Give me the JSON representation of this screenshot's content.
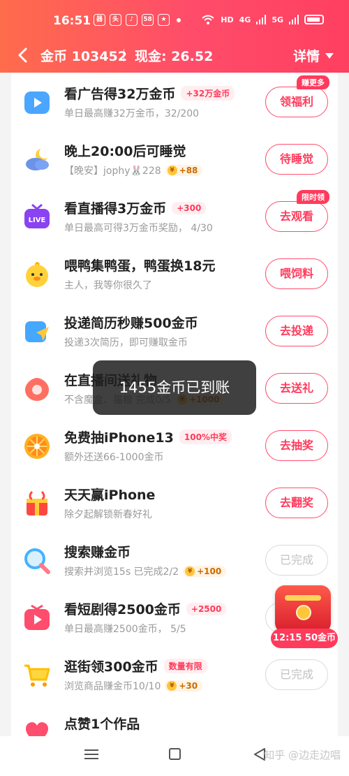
{
  "status_bar": {
    "time": "16:51",
    "app_icons": [
      "wechat-alt-icon",
      "video-app-icon",
      "tiktok-icon",
      "shopping-app-icon",
      "game-app-icon"
    ],
    "right_labels": [
      "HD",
      "4G",
      "5G"
    ]
  },
  "nav": {
    "coins_label": "金币 103452",
    "cash_label": "现金: 26.52",
    "detail_label": "详情"
  },
  "tasks": [
    {
      "icon": "video-play-icon",
      "title": "看广告得32万金币",
      "badge": "+32万金币",
      "subtitle": "单日最高赚32万金币，32/200",
      "coin_badge": "",
      "button": "领福利",
      "tag": "赚更多",
      "done": false
    },
    {
      "icon": "moon-cloud-icon",
      "title": "晚上20:00后可睡觉",
      "badge": "",
      "subtitle": "【晚安】jophy🐰228",
      "coin_badge": "+88",
      "button": "待睡觉",
      "tag": "",
      "done": false
    },
    {
      "icon": "live-tv-icon",
      "title": "看直播得3万金币",
      "badge": "+300",
      "subtitle": "单日最高可得3万金币奖励， 4/30",
      "coin_badge": "",
      "button": "去观看",
      "tag": "限时领",
      "done": false
    },
    {
      "icon": "duck-icon",
      "title": "喂鸭集鸭蛋，鸭蛋换18元",
      "badge": "",
      "subtitle": "主人，我等你很久了",
      "coin_badge": "",
      "button": "喂饲料",
      "tag": "",
      "done": false
    },
    {
      "icon": "resume-icon",
      "title": "投递简历秒赚500金币",
      "badge": "",
      "subtitle": "投递3次简历，即可赚取金币",
      "coin_badge": "",
      "button": "去投递",
      "tag": "",
      "done": false
    },
    {
      "icon": "gift-icon",
      "title": "在直播间送礼物",
      "badge": "",
      "subtitle": "不含魔盒、猫粮 完成0/5",
      "coin_badge": "+1000",
      "button": "去送礼",
      "tag": "",
      "done": false
    },
    {
      "icon": "lottery-wheel-icon",
      "title": "免费抽iPhone13",
      "badge": "100%中奖",
      "subtitle": "额外还送66-1000金币",
      "coin_badge": "",
      "button": "去抽奖",
      "tag": "",
      "done": false
    },
    {
      "icon": "trophy-icon",
      "title": "天天赢iPhone",
      "badge": "",
      "subtitle": "除夕起解锁新春好礼",
      "coin_badge": "",
      "button": "去翻奖",
      "tag": "",
      "done": false
    },
    {
      "icon": "search-icon",
      "title": "搜索赚金币",
      "badge": "",
      "subtitle": "搜索并浏览15s 已完成2/2",
      "coin_badge": "+100",
      "button": "已完成",
      "tag": "",
      "done": true
    },
    {
      "icon": "short-drama-icon",
      "title": "看短剧得2500金币",
      "badge": "+2500",
      "subtitle": "单日最高赚2500金币， 5/5",
      "coin_badge": "",
      "button": "",
      "tag": "",
      "done": true
    },
    {
      "icon": "shopping-cart-icon",
      "title": "逛街领300金币",
      "badge": "数量有限",
      "subtitle": "浏览商品赚金币10/10",
      "coin_badge": "+30",
      "button": "已完成",
      "tag": "",
      "done": true
    },
    {
      "icon": "like-icon",
      "title": "点赞1个作品",
      "badge": "",
      "subtitle": "",
      "coin_badge": "",
      "button": "",
      "tag": "",
      "done": true
    }
  ],
  "toast": {
    "text": "1455金币已到账"
  },
  "floating_gift": {
    "label": "12:15 50金币"
  },
  "bottom_nav": {
    "watermark": "知乎 @边走边唱"
  },
  "colors": {
    "accent": "#ff3b5c",
    "header_start": "#ff6c4c",
    "header_end": "#ff3f60"
  }
}
